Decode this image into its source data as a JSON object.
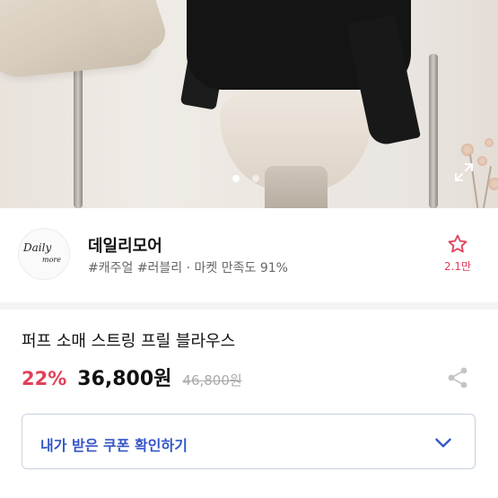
{
  "gallery": {
    "dot_count": 2,
    "active_dot": 1,
    "expand_icon": "expand-icon"
  },
  "seller": {
    "logo_line1": "Daily",
    "logo_line2": "more",
    "name": "데일리모어",
    "tags": "#캐주얼 #러블리 · 마켓 만족도 91%",
    "like_icon": "star-outline-icon",
    "like_count": "2.1만"
  },
  "product": {
    "title": "퍼프 소매 스트링 프릴 블라우스",
    "discount": "22%",
    "price": "36,800원",
    "original_price": "46,800원",
    "share_icon": "share-icon"
  },
  "coupon": {
    "label": "내가 받은 쿠폰 확인하기",
    "icon": "chevron-down-icon"
  },
  "colors": {
    "accent_pink": "#e0405a",
    "link_blue": "#3456c9"
  }
}
